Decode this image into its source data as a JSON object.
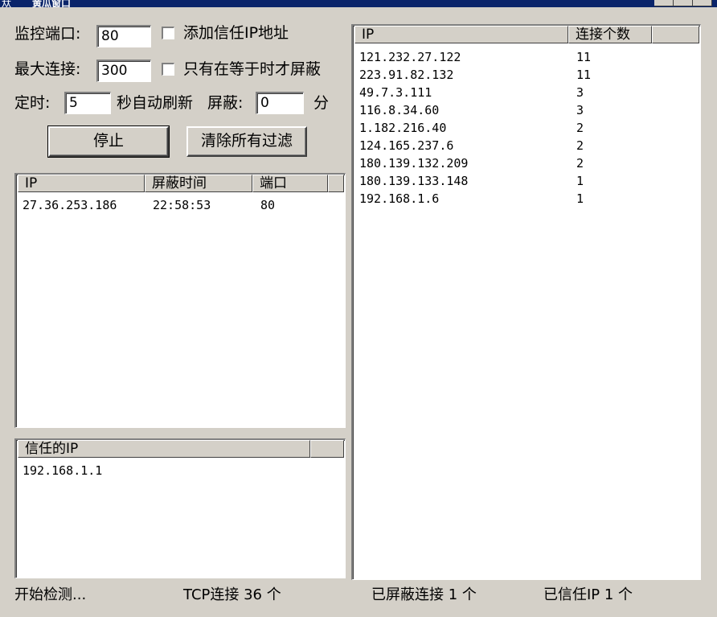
{
  "window": {
    "title_icon": "夶",
    "title": "黄瓜窗口"
  },
  "controls": {
    "port_label": "监控端口:",
    "port_value": "80",
    "trust_ip_label": "添加信任IP地址",
    "max_conn_label": "最大连接:",
    "max_conn_value": "300",
    "only_equal_label": "只有在等于时才屏蔽",
    "timer_label": "定时:",
    "timer_value": "5",
    "refresh_label": "秒自动刷新",
    "block_label": "屏蔽:",
    "block_value": "0",
    "minute_label": "分",
    "stop_button": "停止",
    "clear_button": "清除所有过滤"
  },
  "blocked_list": {
    "headers": [
      "IP",
      "屏蔽时间",
      "端口"
    ],
    "rows": [
      [
        "27.36.253.186",
        "22:58:53",
        "80"
      ]
    ]
  },
  "trusted_list": {
    "headers": [
      "信任的IP"
    ],
    "rows": [
      [
        "192.168.1.1"
      ]
    ]
  },
  "connections_list": {
    "headers": [
      "IP",
      "连接个数"
    ],
    "rows": [
      [
        "121.232.27.122",
        "11"
      ],
      [
        "223.91.82.132",
        "11"
      ],
      [
        "49.7.3.111",
        "3"
      ],
      [
        "116.8.34.60",
        "3"
      ],
      [
        "1.182.216.40",
        "2"
      ],
      [
        "124.165.237.6",
        "2"
      ],
      [
        "180.139.132.209",
        "2"
      ],
      [
        "180.139.133.148",
        "1"
      ],
      [
        "192.168.1.6",
        "1"
      ]
    ]
  },
  "status_bar": {
    "state": "开始检测...",
    "tcp": "TCP连接 36 个",
    "blocked": "已屏蔽连接 1 个",
    "trusted": "已信任IP 1 个"
  },
  "icons": {
    "trust_checkbox": "checkbox-unchecked",
    "only_equal_checkbox": "checkbox-unchecked"
  }
}
